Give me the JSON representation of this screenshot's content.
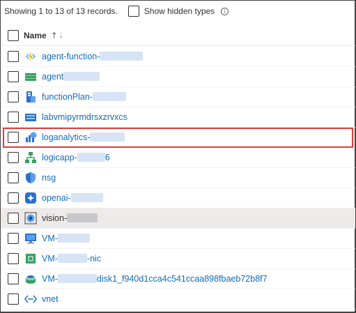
{
  "toolbar": {
    "records_text": "Showing 1 to 13 of 13 records.",
    "show_hidden_label": "Show hidden types",
    "info_glyph": "i"
  },
  "table": {
    "column_name": "Name",
    "sort_glyph": "↑",
    "sort_glyph_alt": "↓"
  },
  "rows": [
    {
      "prefix": "agent-function-",
      "suffix": "",
      "icon": "function-app-icon"
    },
    {
      "prefix": "agent",
      "suffix": "",
      "icon": "storage-account-icon"
    },
    {
      "prefix": "functionPlan-",
      "suffix": "",
      "icon": "app-service-plan-icon"
    },
    {
      "prefix": "labvmipyrmdrsxzrvxcs",
      "suffix": "",
      "icon": "storage-account-icon"
    },
    {
      "prefix": "loganalytics-",
      "suffix": "",
      "icon": "log-analytics-icon"
    },
    {
      "prefix": "logicapp-",
      "suffix": "6",
      "icon": "logic-app-icon"
    },
    {
      "prefix": "nsg",
      "suffix": "",
      "icon": "network-security-group-icon"
    },
    {
      "prefix": "openai-",
      "suffix": "",
      "icon": "openai-icon"
    },
    {
      "prefix": "vision-",
      "suffix": "",
      "icon": "computer-vision-icon"
    },
    {
      "prefix": "VM-",
      "suffix": "",
      "icon": "virtual-machine-icon"
    },
    {
      "prefix": "VM-",
      "suffix": "-nic",
      "icon": "network-interface-icon"
    },
    {
      "prefix": "VM-",
      "suffix": "disk1_f940d1cca4c541ccaa898fbaeb72b8f7",
      "icon": "disk-icon"
    },
    {
      "prefix": "vnet",
      "suffix": "",
      "icon": "virtual-network-icon"
    }
  ],
  "colors": {
    "link": "#0f6cbd",
    "selected_outline": "#e03b3b",
    "hover_row": "#edebe9"
  }
}
